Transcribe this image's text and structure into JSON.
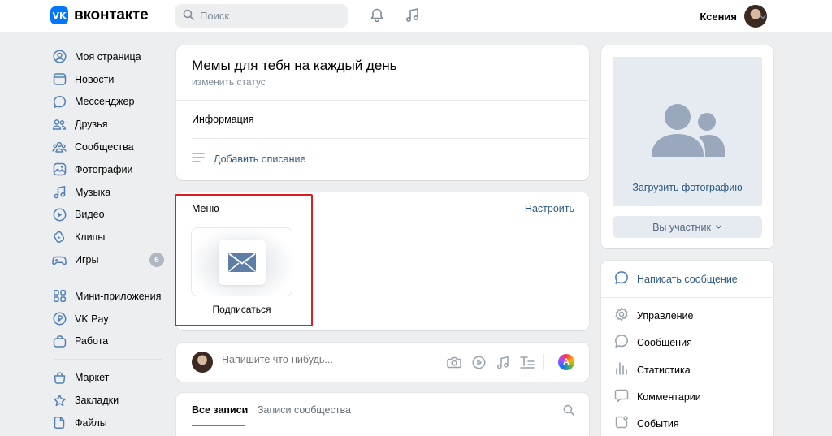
{
  "header": {
    "logo_mark": "VK",
    "logo_text": "вконтакте",
    "search_placeholder": "Поиск",
    "user_name": "Ксения"
  },
  "sidebar": {
    "group1": [
      {
        "label": "Моя страница",
        "icon": "user-circle-icon"
      },
      {
        "label": "Новости",
        "icon": "newspaper-icon"
      },
      {
        "label": "Мессенджер",
        "icon": "message-bubble-icon"
      },
      {
        "label": "Друзья",
        "icon": "friends-icon"
      },
      {
        "label": "Сообщества",
        "icon": "communities-icon"
      },
      {
        "label": "Фотографии",
        "icon": "photo-icon"
      },
      {
        "label": "Музыка",
        "icon": "music-note-icon"
      },
      {
        "label": "Видео",
        "icon": "play-circle-icon"
      },
      {
        "label": "Клипы",
        "icon": "clips-icon"
      },
      {
        "label": "Игры",
        "icon": "gamepad-icon",
        "badge": "6"
      }
    ],
    "group2": [
      {
        "label": "Мини-приложения",
        "icon": "apps-grid-icon"
      },
      {
        "label": "VK Pay",
        "icon": "vk-pay-icon"
      },
      {
        "label": "Работа",
        "icon": "briefcase-icon"
      }
    ],
    "group3": [
      {
        "label": "Маркет",
        "icon": "shopping-bag-icon"
      },
      {
        "label": "Закладки",
        "icon": "star-icon"
      },
      {
        "label": "Файлы",
        "icon": "file-icon"
      }
    ]
  },
  "profile": {
    "title": "Мемы для тебя на каждый день",
    "status": "изменить статус",
    "info_label": "Информация",
    "add_description": "Добавить описание"
  },
  "menu": {
    "title": "Меню",
    "setup": "Настроить",
    "tile_label": "Подписаться"
  },
  "post": {
    "placeholder": "Напишите что-нибудь...",
    "art_letter": "A"
  },
  "tabs": {
    "all": "Все записи",
    "community": "Записи сообщества"
  },
  "photo_card": {
    "upload": "Загрузить фотографию",
    "member": "Вы участник"
  },
  "actions": [
    {
      "label": "Написать сообщение",
      "icon": "message-bubble-icon",
      "primary": true
    },
    {
      "label": "Управление",
      "icon": "gear-icon"
    },
    {
      "label": "Сообщения",
      "icon": "message-bubble-icon"
    },
    {
      "label": "Статистика",
      "icon": "bar-chart-icon"
    },
    {
      "label": "Комментарии",
      "icon": "comment-icon"
    },
    {
      "label": "События",
      "icon": "events-icon"
    }
  ],
  "colors": {
    "accent": "#2a5885",
    "icon": "#5181b8",
    "highlight": "#e11b22",
    "background": "#edeef0"
  }
}
